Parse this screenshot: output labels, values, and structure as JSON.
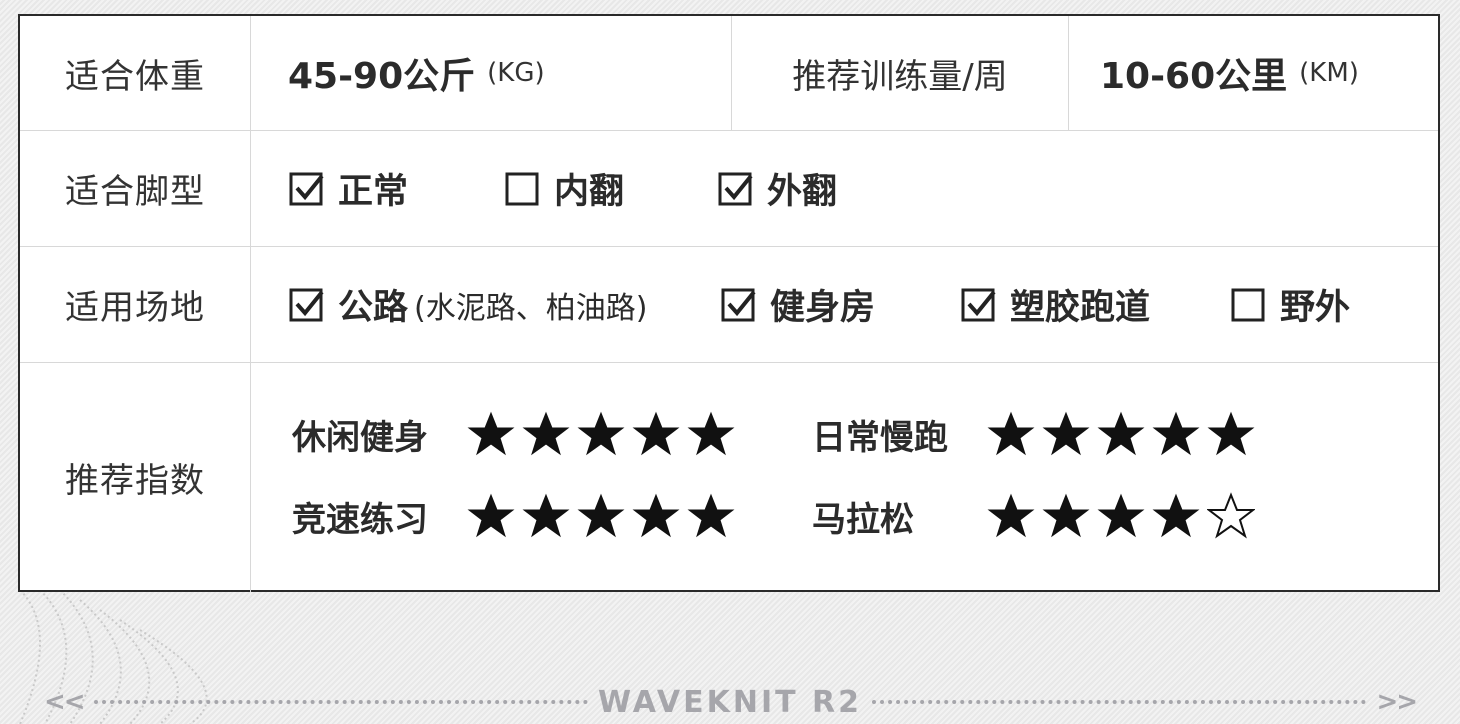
{
  "row_weight": {
    "label": "适合体重",
    "value": "45-90公斤",
    "unit": "(KG)",
    "label2": "推荐训练量/周",
    "value2": "10-60公里",
    "unit2": "(KM)"
  },
  "row_foot": {
    "label": "适合脚型",
    "options": [
      {
        "text": "正常",
        "checked": true
      },
      {
        "text": "内翻",
        "checked": false
      },
      {
        "text": "外翻",
        "checked": true
      }
    ]
  },
  "row_venue": {
    "label": "适用场地",
    "options": [
      {
        "text": "公路",
        "note": "(水泥路、柏油路)",
        "checked": true
      },
      {
        "text": "健身房",
        "checked": true
      },
      {
        "text": "塑胶跑道",
        "checked": true
      },
      {
        "text": "野外",
        "checked": false
      }
    ]
  },
  "row_rating": {
    "label": "推荐指数",
    "items": [
      {
        "name": "休闲健身",
        "stars": 5,
        "max": 5
      },
      {
        "name": "日常慢跑",
        "stars": 5,
        "max": 5
      },
      {
        "name": "竞速练习",
        "stars": 5,
        "max": 5
      },
      {
        "name": "马拉松",
        "stars": 4,
        "max": 5
      }
    ]
  },
  "footer": {
    "left_arrow": "<<",
    "brand": "WAVEKNIT R2",
    "right_arrow": ">>"
  },
  "colors": {
    "background": "#ececec",
    "table_border": "#2a2a2a",
    "text": "#2b2b2b",
    "footer": "#a6a6ab"
  }
}
